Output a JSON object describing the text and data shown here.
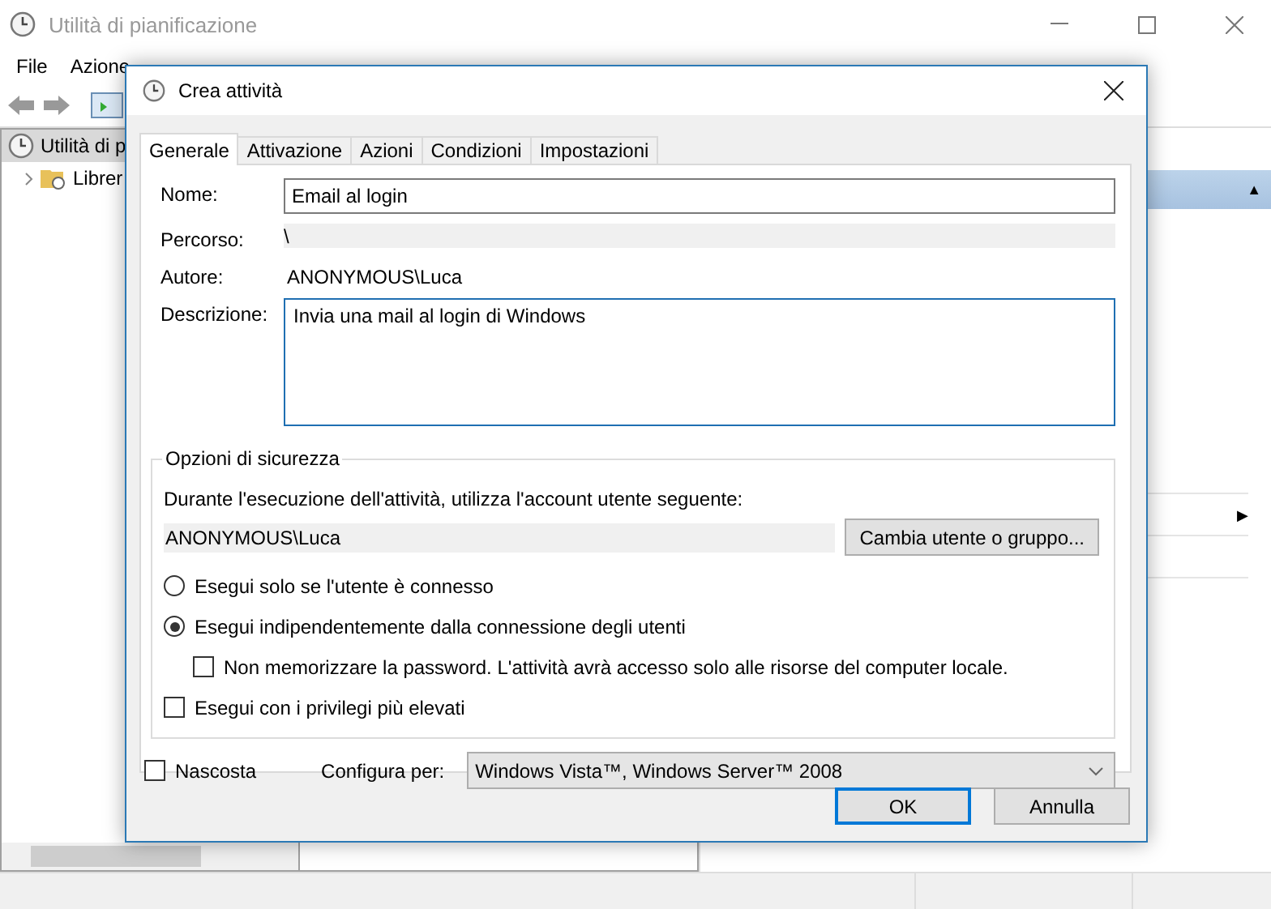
{
  "window": {
    "title": "Utilità di pianificazione"
  },
  "menu": [
    "File",
    "Azione"
  ],
  "tree": [
    {
      "label": "Utilità di p",
      "selected": true,
      "children": [
        {
          "label": "Librer",
          "selected": false
        }
      ]
    }
  ],
  "actions_pane": {
    "header_arrow": "▲",
    "submenu_arrow": "▶"
  },
  "dialog": {
    "title": "Crea attività",
    "tabs": [
      {
        "label": "Generale",
        "selected": true
      },
      {
        "label": "Attivazione",
        "selected": false
      },
      {
        "label": "Azioni",
        "selected": false
      },
      {
        "label": "Condizioni",
        "selected": false
      },
      {
        "label": "Impostazioni",
        "selected": false
      }
    ],
    "fields": [
      {
        "kind": "input",
        "label": "Nome:",
        "value": "Email al login"
      },
      {
        "kind": "readonly",
        "label": "Percorso:",
        "value": "\\"
      },
      {
        "kind": "text",
        "label": "Autore:",
        "value": "ANONYMOUS\\Luca"
      },
      {
        "kind": "textarea",
        "label": "Descrizione:",
        "value": "Invia una mail al login di Windows"
      }
    ],
    "security": {
      "title": "Opzioni di sicurezza",
      "prompt": "Durante l'esecuzione dell'attività, utilizza l'account utente seguente:",
      "account": "ANONYMOUS\\Luca",
      "change_button": "Cambia utente o gruppo...",
      "options": [
        {
          "kind": "radio",
          "label": "Esegui solo se l'utente è connesso",
          "selected": false
        },
        {
          "kind": "radio",
          "label": "Esegui indipendentemente dalla connessione degli utenti",
          "selected": true,
          "children": [
            {
              "kind": "checkbox",
              "label": "Non memorizzare la password. L'attività avrà accesso solo alle risorse del computer locale.",
              "checked": false
            }
          ]
        },
        {
          "kind": "checkbox",
          "label": "Esegui con i privilegi più elevati",
          "checked": false
        }
      ]
    },
    "hidden": {
      "label": "Nascosta",
      "checked": false
    },
    "configure": {
      "label": "Configura per:",
      "value": "Windows Vista™, Windows Server™ 2008"
    },
    "buttons": [
      {
        "label": "OK",
        "default": true
      },
      {
        "label": "Annulla",
        "default": false
      }
    ]
  }
}
